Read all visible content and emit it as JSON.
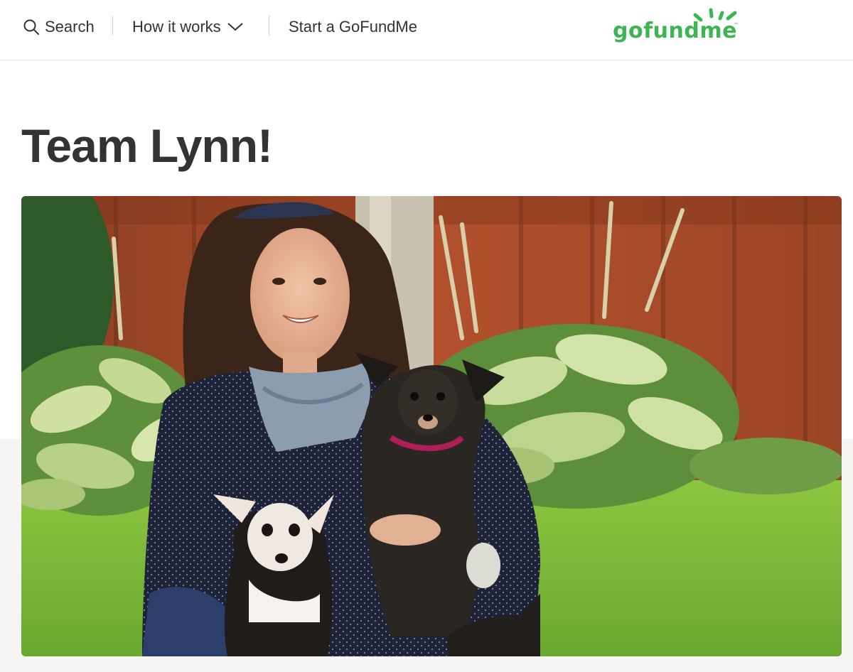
{
  "header": {
    "search_label": "Search",
    "how_it_works_label": "How it works",
    "start_label": "Start a GoFundMe",
    "logo_text": "gofundme",
    "logo_tm": "™"
  },
  "campaign": {
    "title": "Team Lynn!"
  },
  "colors": {
    "brand_green": "#3eb553",
    "text_dark": "#333333"
  }
}
